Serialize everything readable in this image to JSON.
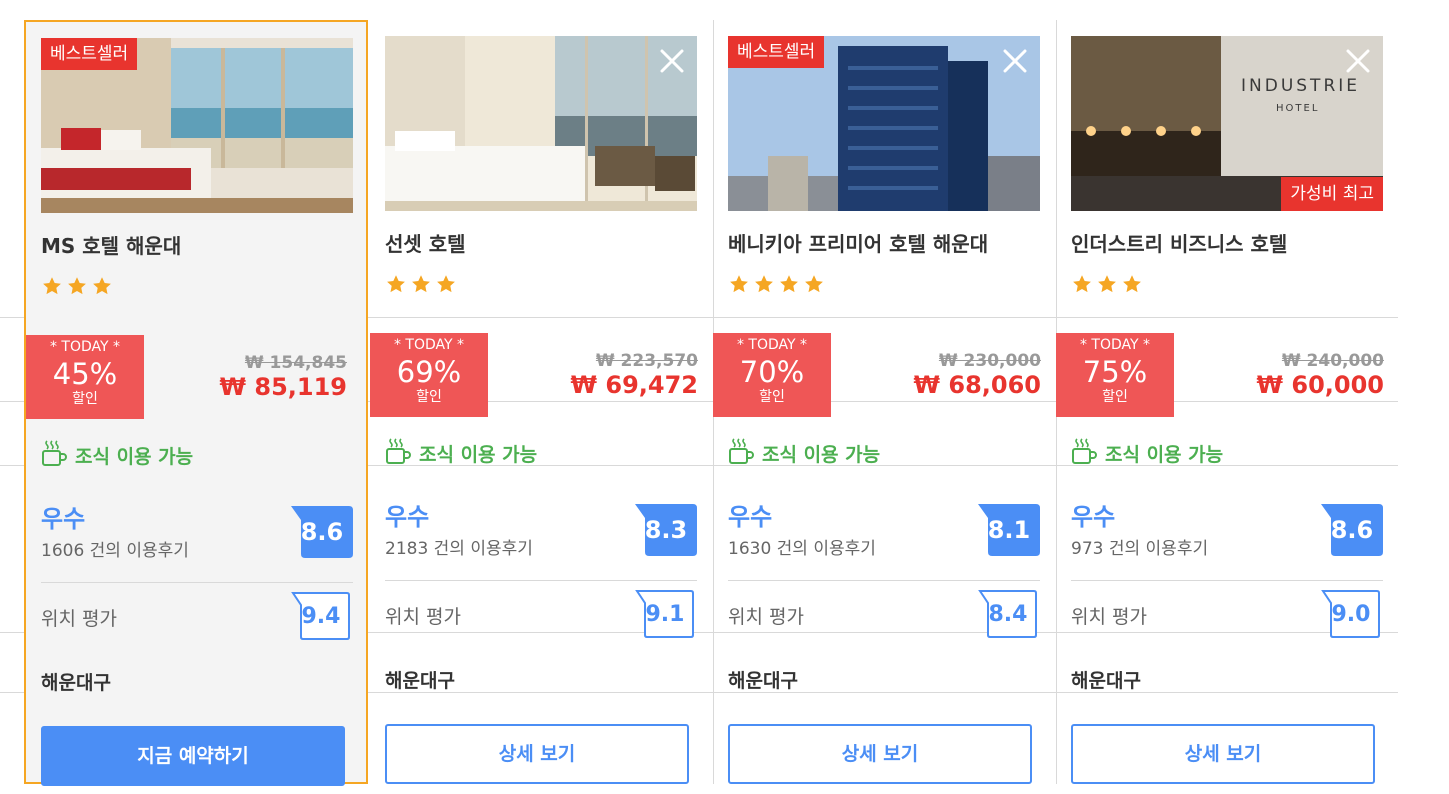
{
  "currency_symbol": "₩",
  "deal_top_label": "* TODAY *",
  "deal_bottom_label": "할인",
  "breakfast_label": "조식 이용 가능",
  "location_label": "위치 평가",
  "colors": {
    "accent_blue": "#4b8ef5",
    "sale_red": "#e8342e",
    "deal_red": "#ef5656",
    "breakfast_green": "#4caf50",
    "star_orange": "#f5a623",
    "selected_border": "#f5a623"
  },
  "hotels": [
    {
      "best_badge": "베스트셀러",
      "value_badge": "",
      "name": "MS 호텔 해운대",
      "stars": 3,
      "discount": "45%",
      "original_price": "₩ 154,845",
      "price": "₩ 85,119",
      "rating_label": "우수",
      "review_count": "1606 건의 이용후기",
      "score": "8.6",
      "location_score": "9.4",
      "district": "해운대구",
      "button": "지금 예약하기",
      "selected": true
    },
    {
      "best_badge": "",
      "value_badge": "",
      "name": "선셋 호텔",
      "stars": 3,
      "discount": "69%",
      "original_price": "₩ 223,570",
      "price": "₩ 69,472",
      "rating_label": "우수",
      "review_count": "2183 건의 이용후기",
      "score": "8.3",
      "location_score": "9.1",
      "district": "해운대구",
      "button": "상세 보기",
      "selected": false
    },
    {
      "best_badge": "베스트셀러",
      "value_badge": "",
      "name": "베니키아 프리미어 호텔 해운대",
      "stars": 4,
      "discount": "70%",
      "original_price": "₩ 230,000",
      "price": "₩ 68,060",
      "rating_label": "우수",
      "review_count": "1630 건의 이용후기",
      "score": "8.1",
      "location_score": "8.4",
      "district": "해운대구",
      "button": "상세 보기",
      "selected": false
    },
    {
      "best_badge": "",
      "value_badge": "가성비 최고",
      "name": "인더스트리 비즈니스 호텔",
      "stars": 3,
      "discount": "75%",
      "original_price": "₩ 240,000",
      "price": "₩ 60,000",
      "rating_label": "우수",
      "review_count": "973 건의 이용후기",
      "score": "8.6",
      "location_score": "9.0",
      "district": "해운대구",
      "button": "상세 보기",
      "selected": false
    }
  ]
}
